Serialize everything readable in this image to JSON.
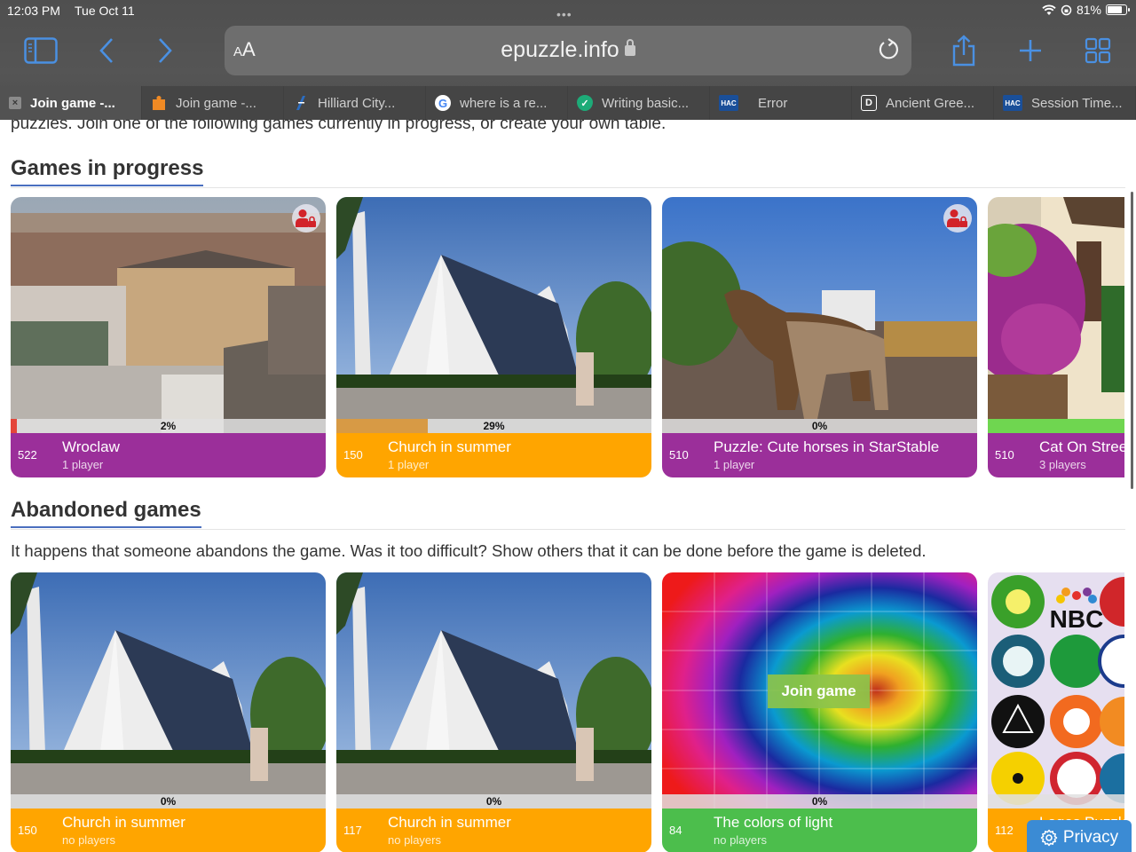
{
  "status_bar": {
    "time": "12:03 PM",
    "date": "Tue Oct 11",
    "battery_percent": "81%",
    "battery_level": 0.81
  },
  "browser": {
    "text_size_label_small": "A",
    "text_size_label_large": "A",
    "url": "epuzzle.info",
    "tabs": [
      {
        "label": "Join game -...",
        "icon": "close-icon",
        "active": true
      },
      {
        "label": "Join game -...",
        "icon": "puzzle-icon",
        "active": false
      },
      {
        "label": "Hilliard City...",
        "icon": "hilliard-icon",
        "active": false
      },
      {
        "label": "where is a re...",
        "icon": "google-icon",
        "active": false
      },
      {
        "label": "Writing basic...",
        "icon": "shield-icon",
        "active": false
      },
      {
        "label": "Error",
        "icon": "hac-icon",
        "active": false
      },
      {
        "label": "Ancient Gree...",
        "icon": "d-icon",
        "active": false
      },
      {
        "label": "Session Time...",
        "icon": "hac-icon",
        "active": false
      }
    ],
    "tab_icon_text": {
      "hac": "HAC",
      "d": "D",
      "g": "G",
      "close": "×"
    }
  },
  "page": {
    "intro_text": "puzzles. Join one of the following games currently in progress, or create your own table.",
    "in_progress": {
      "title": "Games in progress",
      "cards": [
        {
          "pieces": "522",
          "title": "Wroclaw",
          "players": "1 player",
          "progress": 0.02,
          "progress_label": "2%",
          "color": "#9b2f9a",
          "fill": "#e4463a",
          "locked": true
        },
        {
          "pieces": "150",
          "title": "Church in summer",
          "players": "1 player",
          "progress": 0.29,
          "progress_label": "29%",
          "color": "#ffa500",
          "fill": "#d79a45",
          "locked": false
        },
        {
          "pieces": "510",
          "title": "Puzzle: Cute horses in StarStable",
          "players": "1 player",
          "progress": 0.0,
          "progress_label": "0%",
          "color": "#9b2f9a",
          "fill": "#e4463a",
          "locked": true
        },
        {
          "pieces": "510",
          "title": "Cat On Stree",
          "players": "3 players",
          "progress": 1.0,
          "progress_label": "",
          "color": "#9b2f9a",
          "fill": "#6fd650",
          "locked": false
        }
      ]
    },
    "abandoned": {
      "title": "Abandoned games",
      "description": "It happens that someone abandons the game. Was it too difficult? Show others that it can be done before the game is deleted.",
      "join_label": "Join game",
      "cards": [
        {
          "pieces": "150",
          "title": "Church in summer",
          "players": "no players",
          "progress": 0.0,
          "progress_label": "0%",
          "color": "#ffa500"
        },
        {
          "pieces": "117",
          "title": "Church in summer",
          "players": "no players",
          "progress": 0.0,
          "progress_label": "0%",
          "color": "#ffa500"
        },
        {
          "pieces": "84",
          "title": "The colors of light",
          "players": "no players",
          "progress": 0.0,
          "progress_label": "0%",
          "color": "#4cbe4c"
        },
        {
          "pieces": "112",
          "title": "Logos Puzzle",
          "players": "",
          "progress": 0.0,
          "progress_label": "",
          "color": "#ffa500"
        }
      ]
    },
    "logo_tiles": [
      "NBC"
    ],
    "privacy_label": "Privacy"
  }
}
